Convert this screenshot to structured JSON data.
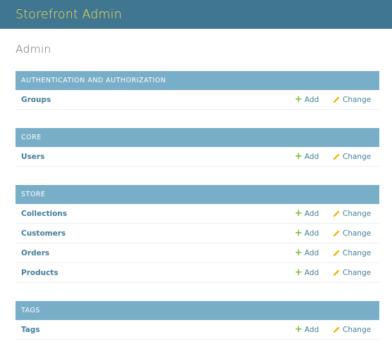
{
  "header": {
    "site_title": "Storefront Admin"
  },
  "page_title": "Admin",
  "colors": {
    "header_bg": "#417690",
    "site_title": "#f5dd5d",
    "caption_bg": "#79aec8",
    "link": "#447e9b",
    "add_icon": "#70bf2b",
    "change_icon": "#efb80b"
  },
  "icons": {
    "add": "plus-icon",
    "change": "pencil-icon"
  },
  "modules": [
    {
      "caption": "Authentication and Authorization",
      "rows": [
        {
          "label": "Groups",
          "add": "Add",
          "change": "Change"
        }
      ]
    },
    {
      "caption": "Core",
      "rows": [
        {
          "label": "Users",
          "add": "Add",
          "change": "Change"
        }
      ]
    },
    {
      "caption": "Store",
      "rows": [
        {
          "label": "Collections",
          "add": "Add",
          "change": "Change"
        },
        {
          "label": "Customers",
          "add": "Add",
          "change": "Change"
        },
        {
          "label": "Orders",
          "add": "Add",
          "change": "Change"
        },
        {
          "label": "Products",
          "add": "Add",
          "change": "Change"
        }
      ]
    },
    {
      "caption": "Tags",
      "rows": [
        {
          "label": "Tags",
          "add": "Add",
          "change": "Change"
        }
      ]
    }
  ]
}
